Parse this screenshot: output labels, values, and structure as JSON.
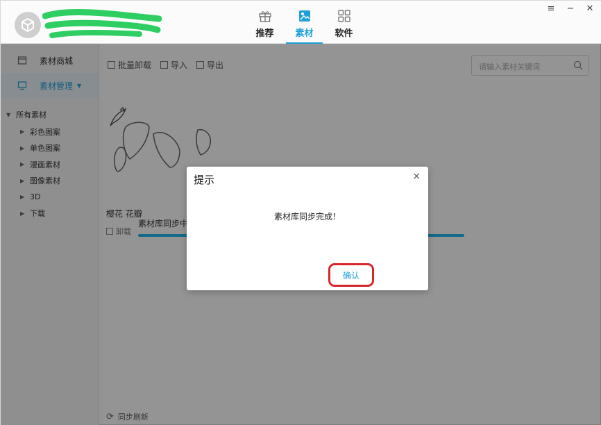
{
  "header": {
    "tabs": [
      {
        "label": "推荐",
        "icon": "gift-icon"
      },
      {
        "label": "素材",
        "icon": "image-icon",
        "active": true
      },
      {
        "label": "软件",
        "icon": "grid-icon"
      }
    ],
    "window_controls": {
      "menu": "≡",
      "minimize": "−",
      "close": "✕"
    }
  },
  "sidebar": {
    "nav": [
      {
        "label": "素材商城",
        "icon": "store-icon"
      },
      {
        "label": "素材管理",
        "icon": "monitor-icon",
        "active": true
      }
    ],
    "tree_root": "所有素材",
    "tree_items": [
      "彩色图案",
      "单色图案",
      "漫画素材",
      "图像素材",
      "3D",
      "下载"
    ]
  },
  "toolbar": {
    "batch_uninstall": "批量卸载",
    "import": "导入",
    "export": "导出",
    "search_placeholder": "请输入素材关键词"
  },
  "item": {
    "name": "樱花 花瓣",
    "uninstall": "卸载"
  },
  "sync": {
    "label": "素材库同步中",
    "progress": 1.0
  },
  "footer": {
    "refresh": "同步刷新"
  },
  "dialog": {
    "title": "提示",
    "close": "×",
    "message": "素材库同步完成！",
    "confirm": "确认"
  },
  "colors": {
    "accent": "#1fa0d8",
    "progress": "#1fb8ea",
    "highlight_ring": "#d8262c"
  }
}
